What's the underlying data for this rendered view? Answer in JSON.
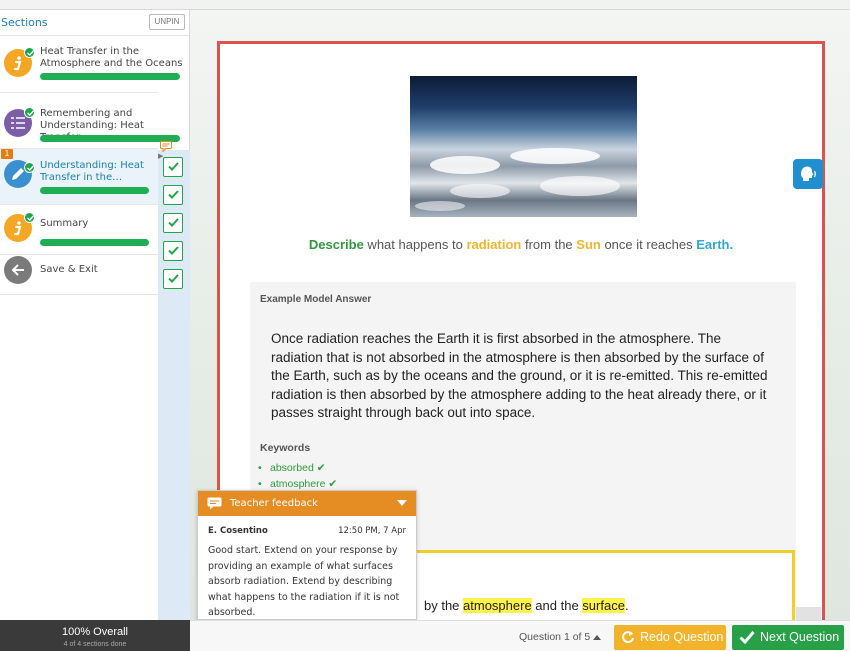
{
  "sidebar": {
    "title": "Sections",
    "unpin_label": "UNPIN",
    "notification_count": "1",
    "items": [
      {
        "label": "Heat Transfer in the Atmosphere and the Oceans",
        "icon": "info-icon",
        "color": "#f5a623",
        "progress": 1.0
      },
      {
        "label": "Remembering and Understanding: Heat Transfer …",
        "icon": "checklist-icon",
        "color": "#7b5ea7",
        "progress": 1.0
      },
      {
        "label": "Understanding: Heat Transfer in the…",
        "icon": "pencil-icon",
        "color": "#3a8fd1",
        "progress": 0.73
      },
      {
        "label": "Summary",
        "icon": "info-icon",
        "color": "#f5a623",
        "progress": 1.0
      },
      {
        "label": "Save & Exit",
        "icon": "arrow-left-icon",
        "color": "#7a7a7a"
      }
    ]
  },
  "question": {
    "w1": "Describe",
    "t1": " what happens to ",
    "w2": "radiation",
    "t2": " from the ",
    "w3": "Sun",
    "t3": " once it reaches ",
    "w4": "Earth",
    "t4": "."
  },
  "model_answer": {
    "title": "Example Model Answer",
    "text": "Once radiation reaches the Earth it is first absorbed in the atmosphere. The radiation that is not absorbed in the atmosphere is then absorbed by the surface of the Earth, such as by the oceans and the ground, or it is re-emitted. This re-emitted radiation is then absorbed by the atmosphere adding to the heat already there, or it passes straight through back out into space.",
    "keywords_title": "Keywords",
    "keywords": [
      "absorbed",
      "atmosphere"
    ]
  },
  "student_answer": {
    "t1": "by the ",
    "h1": "atmosphere",
    "t2": " and the ",
    "h2": "surface",
    "t3": "."
  },
  "feedback": {
    "title": "Teacher feedback",
    "author": "E. Cosentino",
    "time": "12:50 PM, 7 Apr",
    "text": "Good start. Extend on your response by providing an example of what surfaces absorb radiation. Extend by describing what happens to the radiation if it is not absorbed."
  },
  "footer": {
    "overall": "100% Overall",
    "overall_sub": "4 of 4 sections done",
    "question_counter": "Question 1 of 5",
    "redo_label": "Redo Question",
    "next_label": "Next Question"
  },
  "colors": {
    "accent_blue": "#1a7fb3",
    "success_green": "#27a047",
    "redo_yellow": "#f2b32a",
    "feedback_orange": "#e58c22",
    "card_border_red": "#d9534f"
  }
}
